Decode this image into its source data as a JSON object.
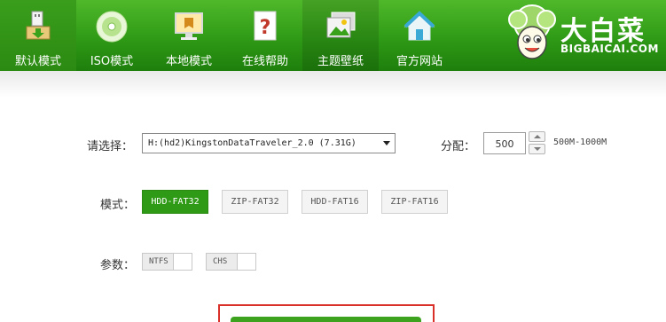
{
  "toolbar": {
    "tabs": [
      {
        "label": "默认模式",
        "icon": "usb-install-icon"
      },
      {
        "label": "ISO模式",
        "icon": "disc-icon"
      },
      {
        "label": "本地模式",
        "icon": "monitor-icon"
      },
      {
        "label": "在线帮助",
        "icon": "help-icon"
      },
      {
        "label": "主题壁纸",
        "icon": "wallpaper-icon"
      },
      {
        "label": "官方网站",
        "icon": "home-icon"
      }
    ],
    "active_tab": "默认模式"
  },
  "brand": {
    "name_cn": "大白菜",
    "name_en": "BIGBAICAI.COM"
  },
  "form": {
    "select_label": "请选择：",
    "selected_device": "H:(hd2)KingstonDataTraveler_2.0 (7.31G)",
    "partition_label": "分配：",
    "partition_value": "500",
    "partition_range": "500M-1000M",
    "mode_label": "模式：",
    "modes": [
      "HDD-FAT32",
      "ZIP-FAT32",
      "HDD-FAT16",
      "ZIP-FAT16"
    ],
    "active_mode": "HDD-FAT32",
    "params_label": "参数：",
    "params": [
      "NTFS",
      "CHS"
    ]
  },
  "colors": {
    "accent": "#2f9a16",
    "highlight_border": "#d9302a"
  }
}
